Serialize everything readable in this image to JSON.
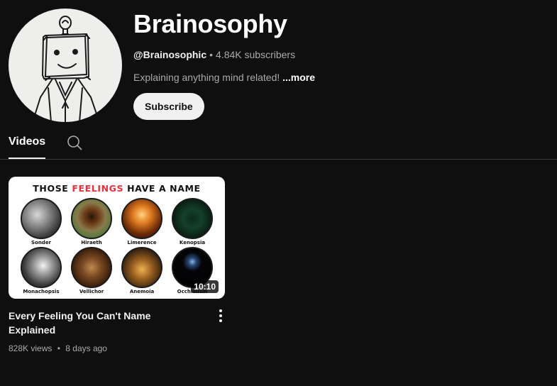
{
  "channel": {
    "name": "Brainosophy",
    "handle": "@Brainosophic",
    "separator": "•",
    "subscribers": "4.84K subscribers",
    "description": "Explaining anything mind related!",
    "more_label": "...more",
    "subscribe_label": "Subscribe"
  },
  "tabs": {
    "videos_label": "Videos",
    "search_icon": "search-icon"
  },
  "video": {
    "thumbnail": {
      "headline_part1": "THOSE",
      "headline_accent": "FEELINGS",
      "headline_part2": "HAVE A NAME",
      "feelings": [
        "Sonder",
        "Hiraeth",
        "Limerence",
        "Kenopsia",
        "Monachopsis",
        "Vellichor",
        "Anemoia",
        "Occhiolism"
      ]
    },
    "duration": "10:10",
    "title": "Every Feeling You Can't Name Explained",
    "views": "828K views",
    "separator": "•",
    "age": "8 days ago",
    "menu_icon": "more-vertical-icon"
  },
  "colors": {
    "background": "#0f0f0f",
    "text_primary": "#f1f1f1",
    "text_secondary": "#aaaaaa",
    "accent_red": "#e8303a",
    "button_bg": "#f1f1f1"
  }
}
